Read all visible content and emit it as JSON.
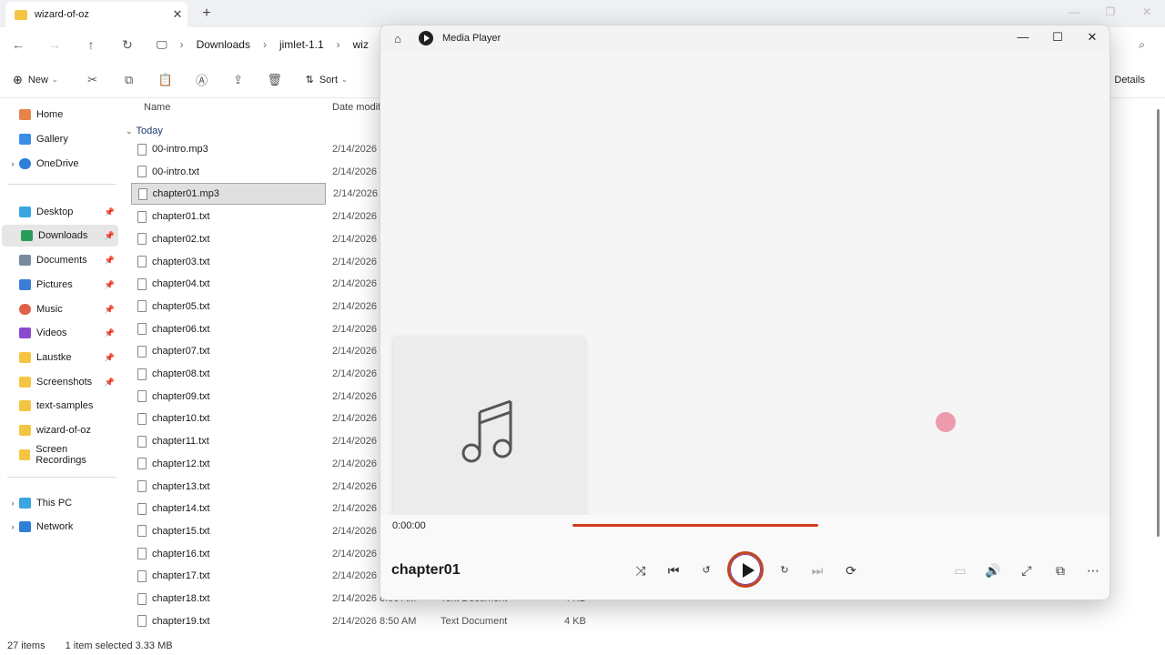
{
  "explorer": {
    "tab_title": "wizard-of-oz",
    "tab_close": "✕",
    "new_tab": "+",
    "breadcrumbs": [
      "Downloads",
      "jimlet-1.1",
      "wiz"
    ],
    "toolbar": {
      "new_label": "New",
      "sort_label": "Sort",
      "details_label": "Details"
    },
    "columns": {
      "name": "Name",
      "date": "Date modifi"
    },
    "group": "Today",
    "sidebar": [
      {
        "label": "Home",
        "icon": "home-icon"
      },
      {
        "label": "Gallery",
        "icon": "gallery-icon"
      },
      {
        "label": "OneDrive",
        "icon": "cloud-icon"
      },
      {
        "label": "Desktop",
        "icon": "desktop-icon"
      },
      {
        "label": "Downloads",
        "icon": "download-icon"
      },
      {
        "label": "Documents",
        "icon": "documents-icon"
      },
      {
        "label": "Pictures",
        "icon": "pictures-icon"
      },
      {
        "label": "Music",
        "icon": "music-icon"
      },
      {
        "label": "Videos",
        "icon": "videos-icon"
      },
      {
        "label": "Laustke",
        "icon": "folder-icon"
      },
      {
        "label": "Screenshots",
        "icon": "folder-icon"
      },
      {
        "label": "text-samples",
        "icon": "folder-icon"
      },
      {
        "label": "wizard-of-oz",
        "icon": "folder-icon"
      },
      {
        "label": "Screen Recordings",
        "icon": "folder-icon"
      },
      {
        "label": "This PC",
        "icon": "pc-icon"
      },
      {
        "label": "Network",
        "icon": "network-icon"
      }
    ],
    "files": [
      {
        "name": "00-intro.mp3",
        "date": "2/14/2026 1"
      },
      {
        "name": "00-intro.txt",
        "date": "2/14/2026 9"
      },
      {
        "name": "chapter01.mp3",
        "date": "2/14/2026 1"
      },
      {
        "name": "chapter01.txt",
        "date": "2/14/2026 8"
      },
      {
        "name": "chapter02.txt",
        "date": "2/14/2026 8"
      },
      {
        "name": "chapter03.txt",
        "date": "2/14/2026 8"
      },
      {
        "name": "chapter04.txt",
        "date": "2/14/2026 8"
      },
      {
        "name": "chapter05.txt",
        "date": "2/14/2026 8"
      },
      {
        "name": "chapter06.txt",
        "date": "2/14/2026 8"
      },
      {
        "name": "chapter07.txt",
        "date": "2/14/2026 8"
      },
      {
        "name": "chapter08.txt",
        "date": "2/14/2026 8"
      },
      {
        "name": "chapter09.txt",
        "date": "2/14/2026 8"
      },
      {
        "name": "chapter10.txt",
        "date": "2/14/2026 8"
      },
      {
        "name": "chapter11.txt",
        "date": "2/14/2026 8"
      },
      {
        "name": "chapter12.txt",
        "date": "2/14/2026 8"
      },
      {
        "name": "chapter13.txt",
        "date": "2/14/2026 8"
      },
      {
        "name": "chapter14.txt",
        "date": "2/14/2026 8"
      },
      {
        "name": "chapter15.txt",
        "date": "2/14/2026 8"
      },
      {
        "name": "chapter16.txt",
        "date": "2/14/2026 8"
      },
      {
        "name": "chapter17.txt",
        "date": "2/14/2026 8"
      },
      {
        "name": "chapter18.txt",
        "date": "2/14/2026 8:50 AM",
        "type": "Text Document",
        "size": "4 KB"
      },
      {
        "name": "chapter19.txt",
        "date": "2/14/2026 8:50 AM",
        "type": "Text Document",
        "size": "4 KB"
      }
    ],
    "status": {
      "count": "27 items",
      "selected": "1 item selected  3.33 MB"
    }
  },
  "player": {
    "app_name": "Media Player",
    "current_time": "0:00:00",
    "track_title": "chapter01",
    "progress": 0,
    "accent_color": "#c2461e"
  }
}
